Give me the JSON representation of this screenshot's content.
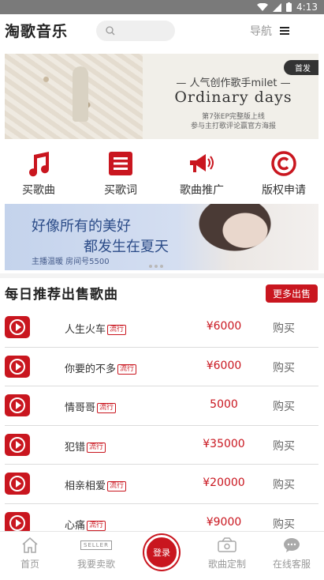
{
  "status_bar": {
    "time": "4:13"
  },
  "header": {
    "app_title": "淘歌音乐",
    "search_placeholder": "",
    "nav_label": "导航"
  },
  "banner_top": {
    "tag": "首发",
    "line1": "— 人气创作歌手milet —",
    "line2": "Ordinary days",
    "line3": "第7张EP完整版上线",
    "line4": "参与主打歌评论赢官方海报"
  },
  "quick_actions": [
    {
      "label": "买歌曲",
      "icon": "music-note-icon"
    },
    {
      "label": "买歌词",
      "icon": "lyrics-list-icon"
    },
    {
      "label": "歌曲推广",
      "icon": "megaphone-icon"
    },
    {
      "label": "版权申请",
      "icon": "copyright-icon"
    }
  ],
  "banner_second": {
    "line1": "好像所有的美好",
    "line2": "都发生在夏天",
    "line3": "主播温暖 房间号5500"
  },
  "daily_section": {
    "title": "每日推荐出售歌曲",
    "more_label": "更多出售"
  },
  "songs": [
    {
      "name": "人生火车",
      "badge": "流行",
      "price": "¥6000",
      "action": "购买"
    },
    {
      "name": "你要的不多",
      "badge": "流行",
      "price": "¥6000",
      "action": "购买"
    },
    {
      "name": "情哥哥",
      "badge": "流行",
      "price": "5000",
      "action": "购买"
    },
    {
      "name": "犯错",
      "badge": "流行",
      "price": "¥35000",
      "action": "购买"
    },
    {
      "name": "相亲相爱",
      "badge": "流行",
      "price": "¥20000",
      "action": "购买"
    },
    {
      "name": "心痛",
      "badge": "流行",
      "price": "¥9000",
      "action": "购买"
    }
  ],
  "tabbar": {
    "home": "首页",
    "sell": "我要卖歌",
    "sell_icon_text": "SELLER",
    "login": "登录",
    "custom": "歌曲定制",
    "service": "在线客服"
  },
  "colors": {
    "accent": "#c9161f"
  }
}
